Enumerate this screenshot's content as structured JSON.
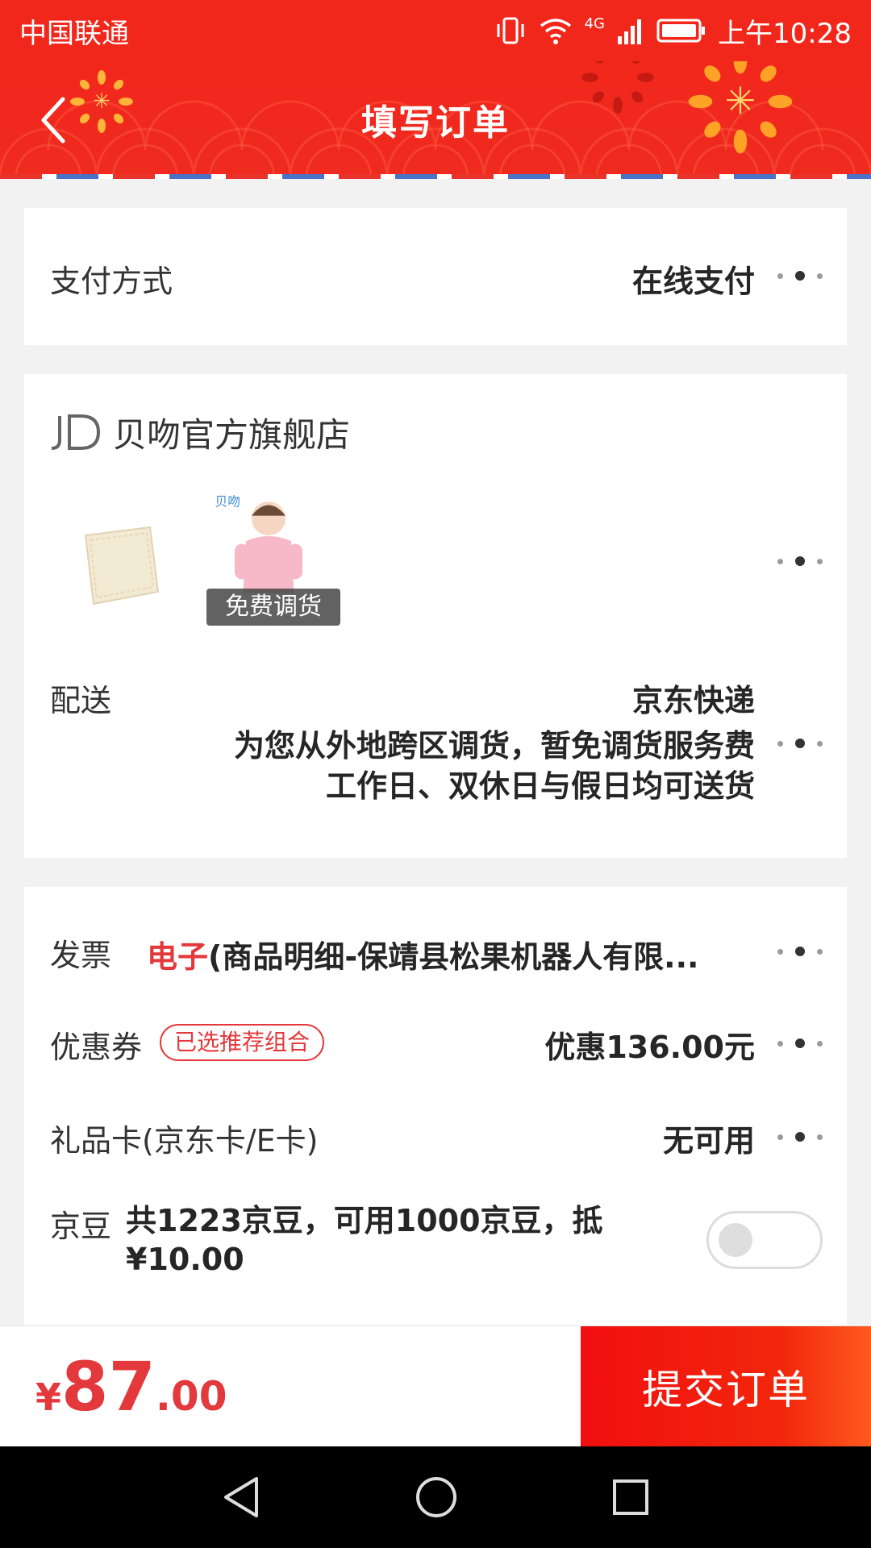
{
  "status_bar": {
    "carrier": "中国联通",
    "network": "4G",
    "time": "上午10:28"
  },
  "header": {
    "title": "填写订单",
    "back_icon": "chevron-left-icon"
  },
  "payment": {
    "label": "支付方式",
    "value": "在线支付"
  },
  "shop": {
    "name": "贝吻官方旗舰店",
    "logo_text": "JD",
    "product_tag": "免费调货",
    "product_brand": "贝吻"
  },
  "delivery": {
    "label": "配送",
    "carrier": "京东快递",
    "note_line1": "为您从外地跨区调货，暂免调货服务费",
    "note_line2": "工作日、双休日与假日均可送货"
  },
  "invoice": {
    "label": "发票",
    "type": "电子",
    "detail": "(商品明细-保靖县松果机器人有限..."
  },
  "coupon": {
    "label": "优惠券",
    "badge": "已选推荐组合",
    "value": "优惠136.00元"
  },
  "gift_card": {
    "label": "礼品卡(京东卡/E卡)",
    "value": "无可用"
  },
  "beans": {
    "label": "京豆",
    "line1": "共1223京豆，可用1000京豆，抵",
    "line2": "¥10.00",
    "enabled": false
  },
  "footer": {
    "currency": "¥",
    "price_int": "87",
    "price_dec": ".00",
    "submit_label": "提交订单"
  },
  "colors": {
    "brand_red": "#f2271c",
    "price_red": "#e4393c"
  }
}
